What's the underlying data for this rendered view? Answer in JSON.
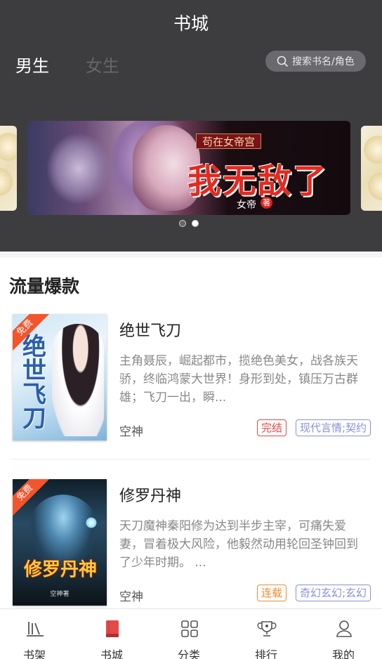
{
  "header": {
    "title": "书城",
    "tabs": [
      {
        "label": "男生",
        "active": true
      },
      {
        "label": "女生",
        "active": false
      }
    ],
    "search": {
      "placeholder": "搜索书名/角色"
    }
  },
  "banner": {
    "subtitle": "苟在女帝宫",
    "title": "我无敌了",
    "author": "女帝",
    "seal": "著",
    "dots": 2,
    "active_dot": 0
  },
  "section": {
    "title": "流量爆款",
    "books": [
      {
        "badge": "免费",
        "cover_title": "绝世飞刀",
        "name": "绝世飞刀",
        "description": "主角聂辰，崛起都市，揽绝色美女，战各族天骄，终临鸿蒙大世界！身形到处，镇压万古群雄；飞刀一出，瞬...",
        "author": "空神",
        "status": "完结",
        "genre": "现代言情;契约"
      },
      {
        "badge": "免费",
        "cover_title": "修罗丹神",
        "cover_author": "空神著",
        "name": "修罗丹神",
        "description": "天刀魔神秦阳修为达到半步主宰，可痛失爱妻，冒着极大风险，他毅然动用轮回圣钟回到了少年时期。 ...",
        "author": "空神",
        "status": "连载",
        "genre": "奇幻玄幻;玄幻"
      }
    ]
  },
  "bottom_nav": [
    {
      "label": "书架",
      "icon": "bookshelf-icon",
      "active": false
    },
    {
      "label": "书城",
      "icon": "bookstore-icon",
      "active": true
    },
    {
      "label": "分类",
      "icon": "category-grid-icon",
      "active": false
    },
    {
      "label": "排行",
      "icon": "trophy-icon",
      "active": false
    },
    {
      "label": "我的",
      "icon": "user-icon",
      "active": false
    }
  ],
  "colors": {
    "header_bg": "#3d3d40",
    "accent_red": "#e24747",
    "status_orange": "#ee8b2c",
    "genre_purple": "#8791d8",
    "ribbon": "#f2552c"
  }
}
